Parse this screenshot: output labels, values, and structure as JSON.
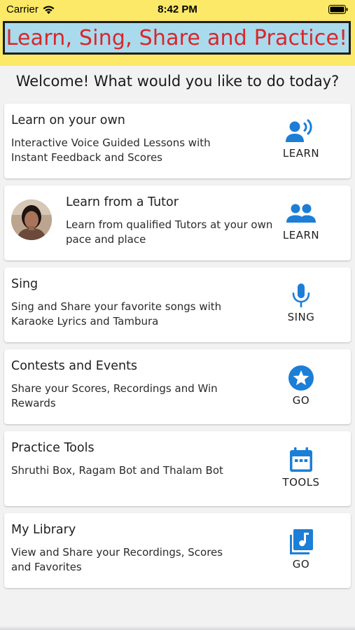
{
  "status_bar": {
    "carrier": "Carrier",
    "time": "8:42 PM"
  },
  "header": {
    "banner": "Learn, Sing, Share and Practice!",
    "background_color": "#fbe967",
    "banner_color": "#a9dbed",
    "banner_text_color": "#d9262a"
  },
  "welcome": "Welcome! What would you like to do today?",
  "accent_color": "#1c7ed6",
  "cards": [
    {
      "title": "Learn on your own",
      "description": "Interactive Voice Guided Lessons with Instant Feedback and Scores",
      "action_label": "LEARN",
      "icon": "voice-person-icon"
    },
    {
      "title": "Learn from a Tutor",
      "description": "Learn from qualified Tutors at your own pace and place",
      "action_label": "LEARN",
      "icon": "people-icon",
      "avatar": "tutor-avatar"
    },
    {
      "title": "Sing",
      "description": "Sing and Share your favorite songs with Karaoke Lyrics and Tambura",
      "action_label": "SING",
      "icon": "microphone-icon"
    },
    {
      "title": "Contests and Events",
      "description": "Share your Scores, Recordings and Win Rewards",
      "action_label": "GO",
      "icon": "star-circle-icon"
    },
    {
      "title": "Practice Tools",
      "description": "Shruthi Box, Ragam Bot and Thalam Bot",
      "action_label": "TOOLS",
      "icon": "calendar-icon"
    },
    {
      "title": "My Library",
      "description": "View and Share your Recordings, Scores and Favorites",
      "action_label": "GO",
      "icon": "music-library-icon"
    }
  ]
}
